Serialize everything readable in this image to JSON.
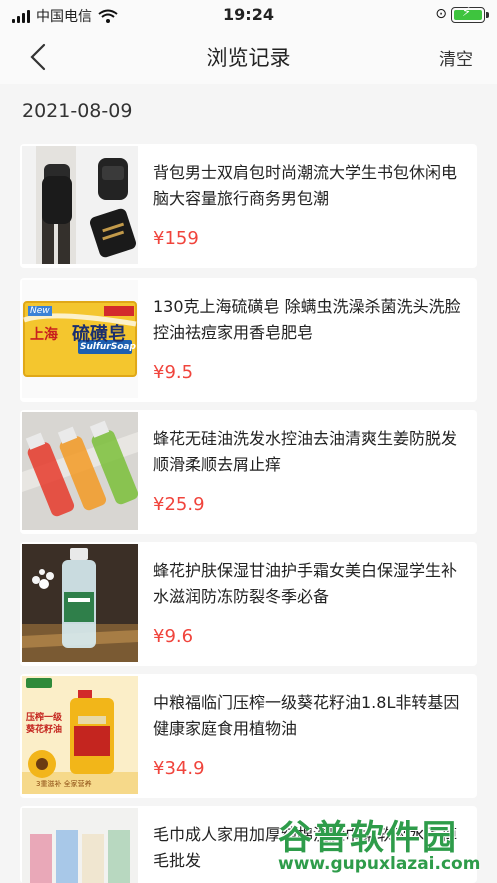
{
  "status_bar": {
    "carrier": "中国电信",
    "time": "19:24"
  },
  "header": {
    "title": "浏览记录",
    "clear_label": "清空"
  },
  "date_group": "2021-08-09",
  "items": [
    {
      "title": "背包男士双肩包时尚潮流大学生书包休闲电脑大容量旅行商务男包潮",
      "price": "¥159"
    },
    {
      "title": "130克上海硫磺皂 除螨虫洗澡杀菌洗头洗脸控油祛痘家用香皂肥皂",
      "price": "¥9.5"
    },
    {
      "title": "蜂花无硅油洗发水控油去油清爽生姜防脱发顺滑柔顺去屑止痒",
      "price": "¥25.9"
    },
    {
      "title": "蜂花护肤保湿甘油护手霜女美白保湿学生补水滋润防冻防裂冬季必备",
      "price": "¥9.6"
    },
    {
      "title": "中粮福临门压榨一级葵花籽油1.8L非转基因健康家庭食用植物油",
      "price": "¥34.9"
    },
    {
      "title": "毛巾成人家用加厚纯棉洗脸巾柔软吸水不掉毛批发",
      "price": ""
    }
  ],
  "soap_box": {
    "badge": "New",
    "brand": "上海",
    "name": "硫磺皂",
    "english": "SulfurSoap"
  },
  "oil_bottle": {
    "line1": "压榨一级",
    "line2": "葵花籽油",
    "footer": "3重滋补 全家营养"
  },
  "watermark": {
    "name": "谷普软件园",
    "url": "www.gupuxlazai.com"
  },
  "colors": {
    "price": "#f0443c",
    "background": "#f5f5f5",
    "watermark": "#2e9c4a"
  }
}
